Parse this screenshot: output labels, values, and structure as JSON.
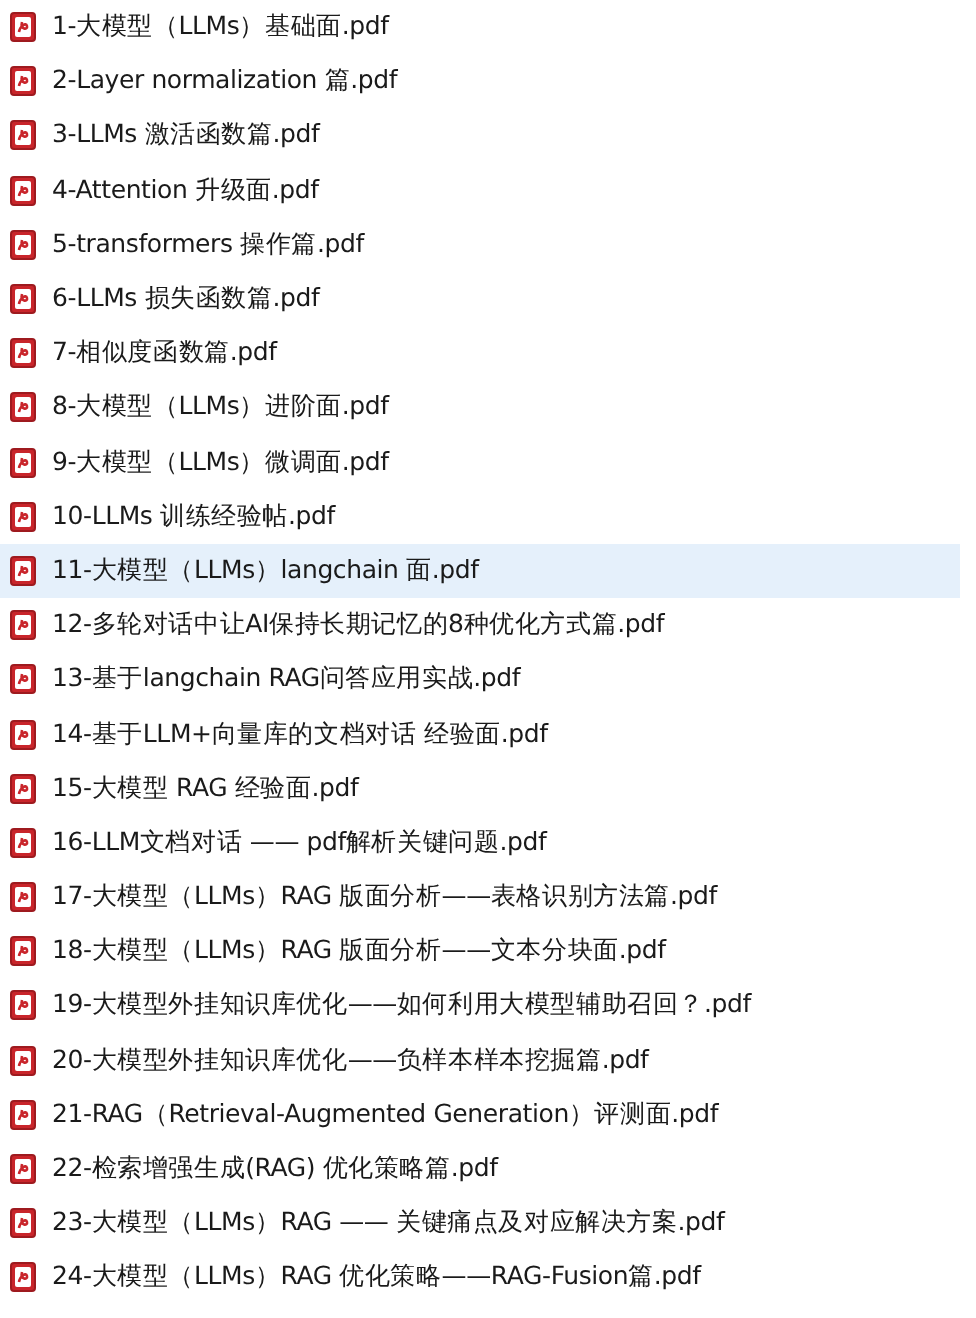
{
  "files": [
    {
      "name": "1-大模型（LLMs）基础面.pdf",
      "selected": false
    },
    {
      "name": "2-Layer normalization 篇.pdf",
      "selected": false
    },
    {
      "name": "3-LLMs 激活函数篇.pdf",
      "selected": false
    },
    {
      "name": "4-Attention 升级面.pdf",
      "selected": false
    },
    {
      "name": "5-transformers 操作篇.pdf",
      "selected": false
    },
    {
      "name": "6-LLMs 损失函数篇.pdf",
      "selected": false
    },
    {
      "name": "7-相似度函数篇.pdf",
      "selected": false
    },
    {
      "name": "8-大模型（LLMs）进阶面.pdf",
      "selected": false
    },
    {
      "name": "9-大模型（LLMs）微调面.pdf",
      "selected": false
    },
    {
      "name": "10-LLMs 训练经验帖.pdf",
      "selected": false
    },
    {
      "name": "11-大模型（LLMs）langchain 面.pdf",
      "selected": true
    },
    {
      "name": "12-多轮对话中让AI保持长期记忆的8种优化方式篇.pdf",
      "selected": false
    },
    {
      "name": "13-基于langchain RAG问答应用实战.pdf",
      "selected": false
    },
    {
      "name": "14-基于LLM+向量库的文档对话 经验面.pdf",
      "selected": false
    },
    {
      "name": "15-大模型 RAG 经验面.pdf",
      "selected": false
    },
    {
      "name": "16-LLM文档对话 —— pdf解析关键问题.pdf",
      "selected": false
    },
    {
      "name": "17-大模型（LLMs）RAG 版面分析——表格识别方法篇.pdf",
      "selected": false
    },
    {
      "name": "18-大模型（LLMs）RAG 版面分析——文本分块面.pdf",
      "selected": false
    },
    {
      "name": "19-大模型外挂知识库优化——如何利用大模型辅助召回？.pdf",
      "selected": false
    },
    {
      "name": "20-大模型外挂知识库优化——负样本样本挖掘篇.pdf",
      "selected": false
    },
    {
      "name": "21-RAG（Retrieval-Augmented Generation）评测面.pdf",
      "selected": false
    },
    {
      "name": "22-检索增强生成(RAG) 优化策略篇.pdf",
      "selected": false
    },
    {
      "name": "23-大模型（LLMs）RAG —— 关键痛点及对应解决方案.pdf",
      "selected": false
    },
    {
      "name": "24-大模型（LLMs）RAG 优化策略——RAG-Fusion篇.pdf",
      "selected": false
    }
  ]
}
